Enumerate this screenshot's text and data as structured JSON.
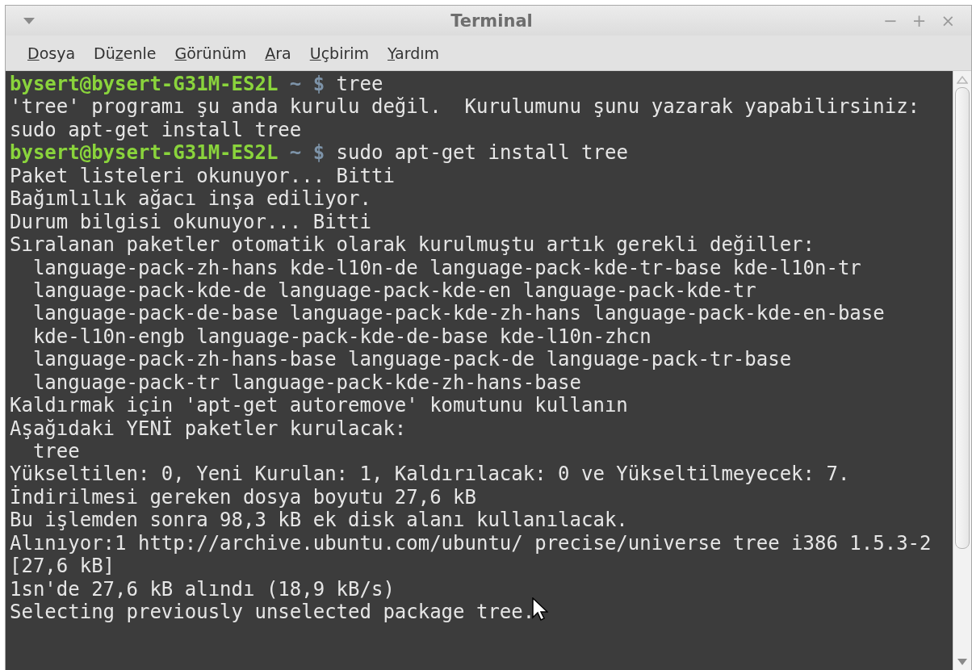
{
  "window": {
    "title": "Terminal",
    "controls": [
      "−",
      "+",
      "×"
    ]
  },
  "menu": [
    {
      "label_parts": [
        {
          "text": "D",
          "underlined": true
        },
        {
          "text": "osya",
          "underlined": false
        }
      ]
    },
    {
      "label_parts": [
        {
          "text": "Dü",
          "underlined": false
        },
        {
          "text": "z",
          "underlined": true
        },
        {
          "text": "enle",
          "underlined": false
        }
      ]
    },
    {
      "label_parts": [
        {
          "text": "G",
          "underlined": true
        },
        {
          "text": "örünüm",
          "underlined": false
        }
      ]
    },
    {
      "label_parts": [
        {
          "text": "A",
          "underlined": true
        },
        {
          "text": "ra",
          "underlined": false
        }
      ]
    },
    {
      "label_parts": [
        {
          "text": "U",
          "underlined": true
        },
        {
          "text": "çbirim",
          "underlined": false
        }
      ]
    },
    {
      "label_parts": [
        {
          "text": "Y",
          "underlined": true
        },
        {
          "text": "ardım",
          "underlined": false
        }
      ]
    }
  ],
  "terminal": {
    "lines": [
      {
        "kind": "prompt",
        "user_host": "bysert@bysert-G31M-ES2L",
        "dir": "~",
        "symbol": "$",
        "command": "tree"
      },
      {
        "kind": "output",
        "text": "'tree' programı şu anda kurulu değil.  Kurulumunu şunu yazarak yapabilirsiniz:"
      },
      {
        "kind": "output",
        "text": "sudo apt-get install tree"
      },
      {
        "kind": "prompt",
        "user_host": "bysert@bysert-G31M-ES2L",
        "dir": "~",
        "symbol": "$",
        "command": "sudo apt-get install tree"
      },
      {
        "kind": "output",
        "text": "Paket listeleri okunuyor... Bitti"
      },
      {
        "kind": "output",
        "text": "Bağımlılık ağacı inşa ediliyor."
      },
      {
        "kind": "output",
        "text": "Durum bilgisi okunuyor... Bitti"
      },
      {
        "kind": "output",
        "text": "Sıralanan paketler otomatik olarak kurulmuştu artık gerekli değiller:"
      },
      {
        "kind": "output",
        "text": "  language-pack-zh-hans kde-l10n-de language-pack-kde-tr-base kde-l10n-tr"
      },
      {
        "kind": "output",
        "text": "  language-pack-kde-de language-pack-kde-en language-pack-kde-tr"
      },
      {
        "kind": "output",
        "text": "  language-pack-de-base language-pack-kde-zh-hans language-pack-kde-en-base"
      },
      {
        "kind": "output",
        "text": "  kde-l10n-engb language-pack-kde-de-base kde-l10n-zhcn"
      },
      {
        "kind": "output",
        "text": "  language-pack-zh-hans-base language-pack-de language-pack-tr-base"
      },
      {
        "kind": "output",
        "text": "  language-pack-tr language-pack-kde-zh-hans-base"
      },
      {
        "kind": "output",
        "text": "Kaldırmak için 'apt-get autoremove' komutunu kullanın"
      },
      {
        "kind": "output",
        "text": "Aşağıdaki YENİ paketler kurulacak:"
      },
      {
        "kind": "output",
        "text": "  tree"
      },
      {
        "kind": "output",
        "text": "Yükseltilen: 0, Yeni Kurulan: 1, Kaldırılacak: 0 ve Yükseltilmeyecek: 7."
      },
      {
        "kind": "output",
        "text": "İndirilmesi gereken dosya boyutu 27,6 kB"
      },
      {
        "kind": "output",
        "text": "Bu işlemden sonra 98,3 kB ek disk alanı kullanılacak."
      },
      {
        "kind": "output",
        "text": "Alınıyor:1 http://archive.ubuntu.com/ubuntu/ precise/universe tree i386 1.5.3-2"
      },
      {
        "kind": "output",
        "text": "[27,6 kB]"
      },
      {
        "kind": "output",
        "text": "1sn'de 27,6 kB alındı (18,9 kB/s)"
      },
      {
        "kind": "output",
        "text": "Selecting previously unselected package tree."
      }
    ]
  }
}
